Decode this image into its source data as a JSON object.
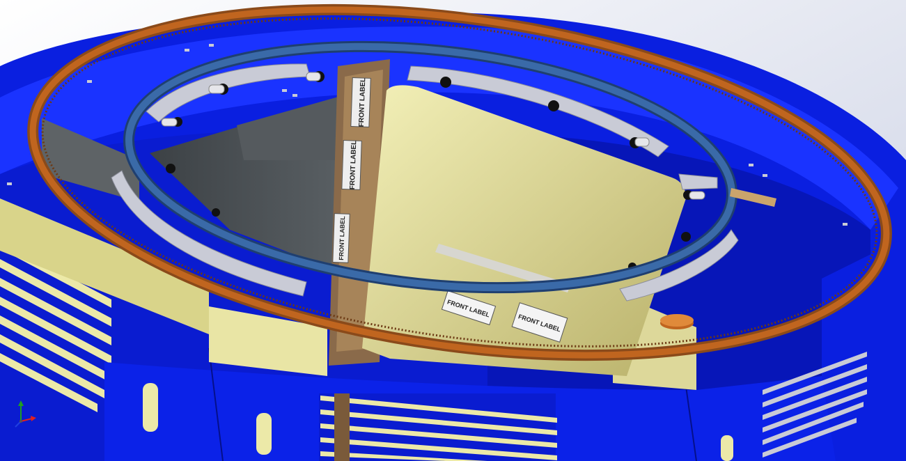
{
  "viewport": {
    "background_top": "#ffffff",
    "background_bottom": "#c9cfe3"
  },
  "model": {
    "colors": {
      "frame_blue": "#0a1fe0",
      "frame_blue_dark": "#0612a8",
      "frame_blue_light": "#2a44ff",
      "gear_ring": "#c0651f",
      "gear_teeth": "#8a4a1a",
      "inner_ring": "#3a6aa8",
      "inner_ring_dark": "#1f3f70",
      "panel_yellow": "#ece9a8",
      "panel_yellow_shade": "#c9c27a",
      "panel_dark": "#4a4f52",
      "bracket_gray": "#c9cbd6",
      "pin_black": "#111111"
    },
    "labels": [
      {
        "text": "FRONT LABEL"
      },
      {
        "text": "FRONT LABEL"
      },
      {
        "text": "FRONT LABEL"
      },
      {
        "text": "FRONT LABEL"
      },
      {
        "text": "FRONT LABEL"
      }
    ]
  },
  "triad": {
    "x_color": "#e02020",
    "y_color": "#20a020",
    "z_color": "#2040e0"
  }
}
